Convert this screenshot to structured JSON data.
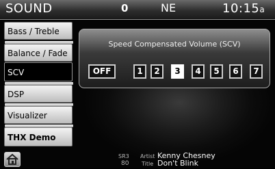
{
  "header": {
    "title": "SOUND",
    "status_count": "0",
    "compass": "NE",
    "clock": "10:15",
    "clock_suffix": "a"
  },
  "sidebar": {
    "items": [
      {
        "label": "Bass / Treble",
        "active": false
      },
      {
        "label": "Balance / Fade",
        "active": false
      },
      {
        "label": "SCV",
        "active": true
      },
      {
        "label": "DSP",
        "active": false
      },
      {
        "label": "Visualizer",
        "active": false
      },
      {
        "label": "THX Demo",
        "active": false
      }
    ]
  },
  "scv_panel": {
    "title": "Speed Compensated Volume (SCV)",
    "options": [
      "OFF",
      "1",
      "2",
      "3",
      "4",
      "5",
      "6",
      "7"
    ],
    "selected": "3"
  },
  "footer": {
    "home_icon": "home-icon",
    "band_label": "SR3",
    "channel": "80",
    "artist_label": "Artist",
    "artist": "Kenny Chesney",
    "title_label": "Title",
    "song_title": "Don't Blink"
  }
}
